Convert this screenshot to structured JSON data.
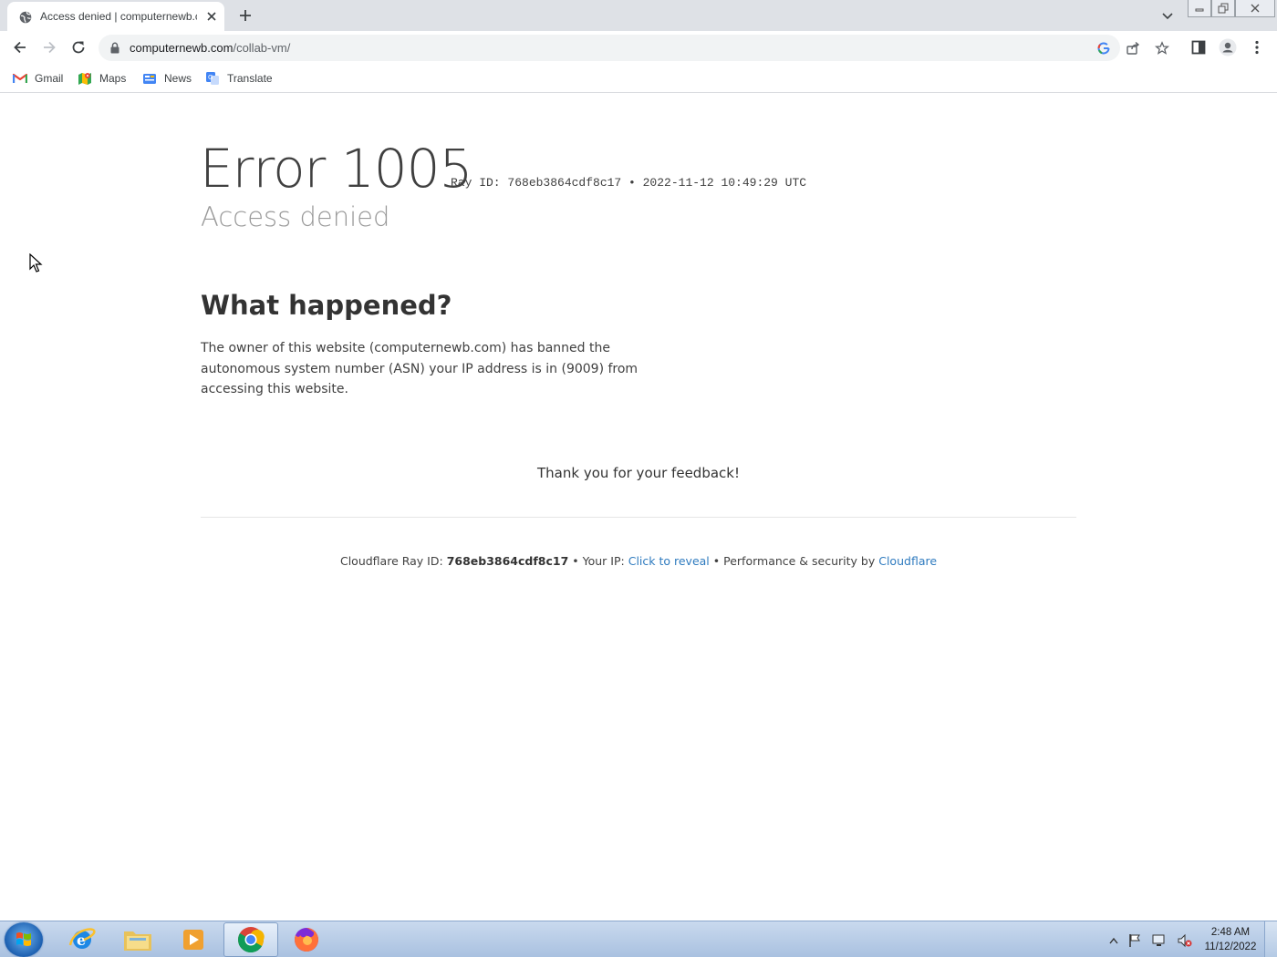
{
  "browser": {
    "tab": {
      "title": "Access denied | computernewb.c"
    },
    "address_bar": {
      "host": "computernewb.com",
      "path": "/collab-vm/"
    },
    "bookmarks": [
      "Gmail",
      "Maps",
      "News",
      "Translate"
    ]
  },
  "page": {
    "error_code": "Error 1005",
    "ray_line": "Ray ID: 768eb3864cdf8c17 • 2022-11-12 10:49:29 UTC",
    "subtitle": "Access denied",
    "what_happened_heading": "What happened?",
    "what_happened_text": "The owner of this website (computernewb.com) has banned the autonomous system number (ASN) your IP address is in (9009) from accessing this website.",
    "feedback": "Thank you for your feedback!",
    "footer": {
      "ray_label": "Cloudflare Ray ID:",
      "ray_id": "768eb3864cdf8c17",
      "sep1": "•",
      "ip_label": "Your IP:",
      "ip_link": "Click to reveal",
      "sep2": "•",
      "perf_label": "Performance & security by",
      "cf_link": "Cloudflare"
    }
  },
  "taskbar": {
    "clock_time": "2:48 AM",
    "clock_date": "11/12/2022"
  },
  "colors": {
    "link": "#2f7bbf",
    "tabstrip": "#dee1e6",
    "taskbar": "#b8cde8"
  }
}
